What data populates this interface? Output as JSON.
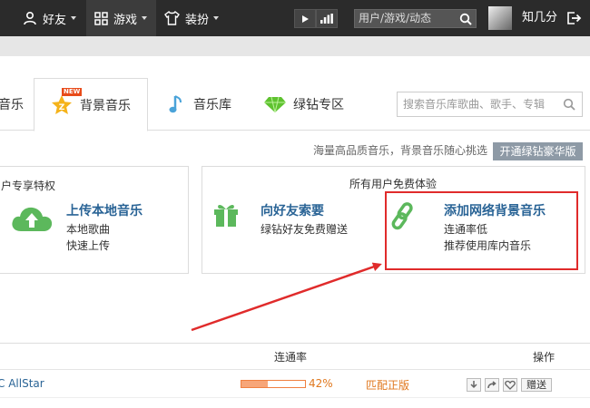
{
  "nav": {
    "friends": "好友",
    "games": "游戏",
    "dressup": "装扮",
    "search_placeholder": "用户/游戏/动态",
    "username": "知几分"
  },
  "tabs": {
    "partial": "音乐",
    "bgmusic": "背景音乐",
    "badge_new": "NEW",
    "library": "音乐库",
    "vip": "绿钻专区",
    "search_placeholder": "搜索音乐库歌曲、歌手、专辑"
  },
  "promo": {
    "text": "海量高品质音乐，背景音乐随心挑选",
    "button": "开通绿钻豪华版"
  },
  "panels": {
    "left_title": "户专享特权",
    "upload_title": "上传本地音乐",
    "upload_sub1": "本地歌曲",
    "upload_sub2": "快速上传",
    "right_title": "所有用户免费体验",
    "ask_title": "向好友索要",
    "ask_sub": "绿钻好友免费赠送",
    "addnet_title": "添加网络背景音乐",
    "addnet_sub1": "连通率低",
    "addnet_sub2": "推荐使用库内音乐"
  },
  "table": {
    "col_rate": "连通率",
    "col_ops": "操作",
    "rows": [
      {
        "name": "C AllStar",
        "rate_pct": "42%",
        "rate_value": 0.42,
        "match": "匹配正版",
        "gift": "赠送"
      }
    ]
  },
  "colors": {
    "accent_link": "#2a6496",
    "promo_button": "#8e9aa6",
    "highlight_red": "#e02b2b",
    "progress_fill": "#f7a679",
    "match_text": "#e0781e"
  }
}
